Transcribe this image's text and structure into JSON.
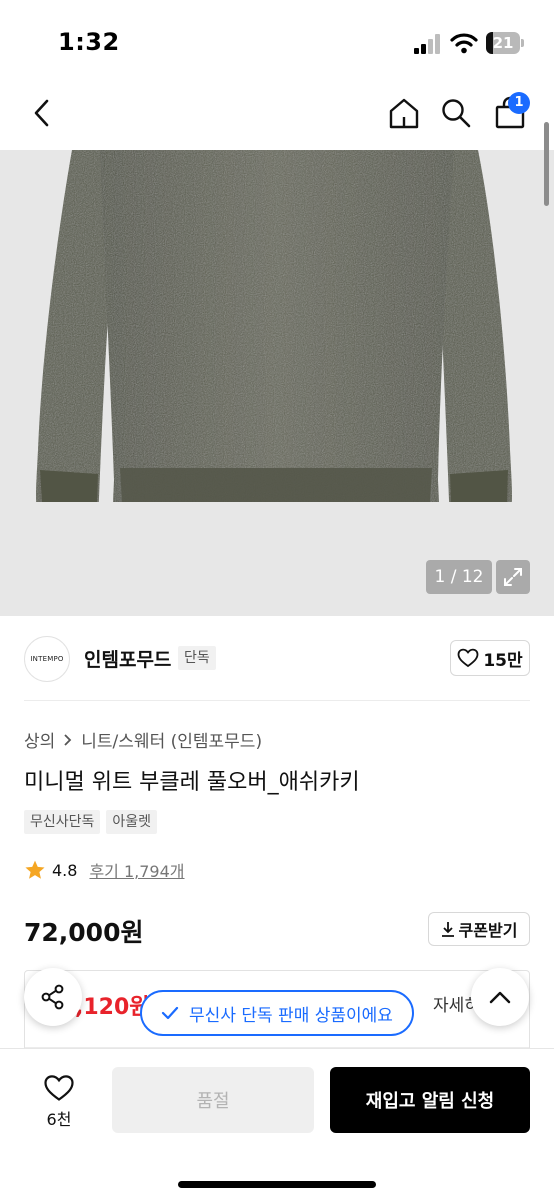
{
  "status_bar": {
    "time": "1:32",
    "battery_level": "21",
    "battery_fraction": 0.21
  },
  "nav": {
    "cart_count": "1"
  },
  "image": {
    "counter": "1 / 12"
  },
  "brand": {
    "logo_text": "INTEMPO",
    "name": "인템포무드",
    "tag": "단독",
    "likes": "15만"
  },
  "product": {
    "breadcrumb": [
      "상의",
      "니트/스웨터 (인템포무드)"
    ],
    "title": "미니멀 위트 부클레 풀오버_애쉬카키",
    "tags": [
      "무신사단독",
      "아울렛"
    ],
    "rating": "4.8",
    "review_link": "후기 1,794개",
    "price": "72,000원",
    "coupon_label": "쿠폰받기"
  },
  "discount": {
    "price_partial": ",120원",
    "detail_partial": "자세히"
  },
  "exclusive_banner": "무신사 단독 판매 상품이에요",
  "bottom_bar": {
    "wish_count": "6천",
    "soldout_label": "품절",
    "restock_label": "재입고 알림 신청"
  },
  "colors": {
    "accent_blue": "#1a6bff",
    "discount_red": "#e8232b",
    "sweater": "#5f6150"
  }
}
